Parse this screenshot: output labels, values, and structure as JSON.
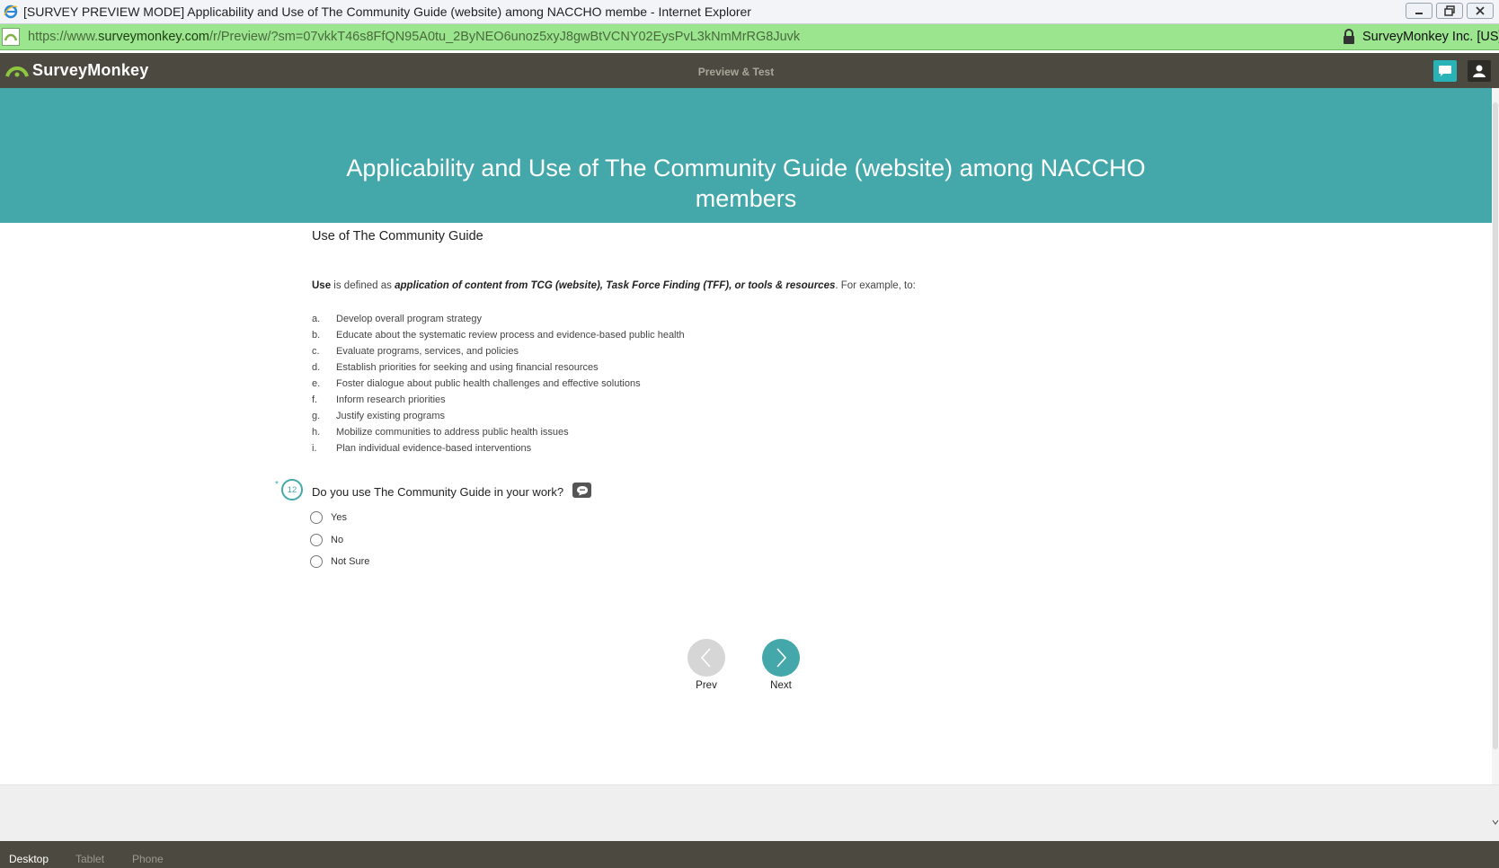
{
  "window": {
    "title": "[SURVEY PREVIEW MODE] Applicability and Use of The Community Guide (website) among NACCHO membe - Internet Explorer"
  },
  "address": {
    "url_scheme": "https://www.",
    "url_host": "surveymonkey.com",
    "url_path": "/r/Preview/?sm=07vkkT46s8FfQN95A0tu_2ByNEO6unoz5xyJ8gwBtVCNY02EysPvL3kNmMrRG8Juvk",
    "cert": "SurveyMonkey Inc. [US]"
  },
  "topbar": {
    "logo": "SurveyMonkey",
    "mode": "Preview & Test"
  },
  "survey": {
    "title": "Applicability and Use of The Community Guide (website) among NACCHO members",
    "section_title": "Use of The Community Guide",
    "definition": {
      "term": "Use",
      "middle": " is defined as ",
      "emphasis": "application of content from TCG (website), Task Force Finding (TFF), or tools & resources",
      "tail": ". For example, to:"
    },
    "examples": [
      {
        "letter": "a.",
        "text": "Develop overall program strategy"
      },
      {
        "letter": "b.",
        "text": "Educate about the systematic review process and evidence-based public health"
      },
      {
        "letter": "c.",
        "text": "Evaluate programs, services, and policies"
      },
      {
        "letter": "d.",
        "text": "Establish priorities for seeking and using financial resources"
      },
      {
        "letter": "e.",
        "text": "Foster dialogue about public health challenges and effective solutions"
      },
      {
        "letter": "f.",
        "text": "Inform research priorities"
      },
      {
        "letter": "g.",
        "text": "Justify existing programs"
      },
      {
        "letter": "h.",
        "text": "Mobilize communities to address public health issues"
      },
      {
        "letter": "i.",
        "text": "Plan individual evidence-based interventions"
      }
    ],
    "question": {
      "required_mark": "*",
      "number": "12",
      "text": "Do you use The Community Guide in your work?",
      "options": [
        "Yes",
        "No",
        "Not Sure"
      ]
    },
    "nav": {
      "prev": "Prev",
      "next": "Next"
    }
  },
  "devices": {
    "tabs": [
      "Desktop",
      "Tablet",
      "Phone"
    ],
    "active": "Desktop"
  },
  "colors": {
    "teal": "#44a8ab",
    "bar": "#4c4a40",
    "address_green": "#9be58f"
  }
}
